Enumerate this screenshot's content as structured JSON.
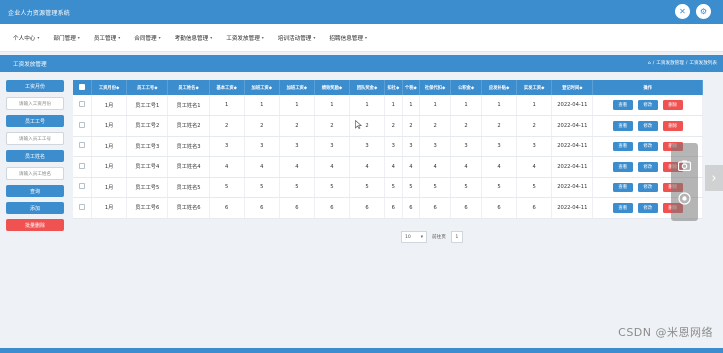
{
  "app": {
    "title": "企业人力资源管理系统"
  },
  "menu": [
    {
      "label": "个人中心"
    },
    {
      "label": "部门管理"
    },
    {
      "label": "员工管理"
    },
    {
      "label": "合同管理"
    },
    {
      "label": "考勤信息管理"
    },
    {
      "label": "工资发放管理"
    },
    {
      "label": "培训活动管理"
    },
    {
      "label": "招聘信息管理"
    }
  ],
  "section": {
    "title": "工资发放管理",
    "breadcrumb": [
      "⌂",
      "/",
      "工资发放管理",
      "/",
      "工资发放列表"
    ]
  },
  "filters": {
    "month_label": "工资月份",
    "month_placeholder": "请输入工资月份",
    "employee_no_label": "员工工号",
    "employee_no_placeholder": "请输入员工工号",
    "employee_name_label": "员工姓名",
    "employee_name_placeholder": "请输入员工姓名",
    "search_button": "查询",
    "add_button": "添加",
    "batch_delete_button": "批量删除"
  },
  "table": {
    "headers": [
      "",
      "工资月份◆",
      "员工工号◆",
      "员工姓名◆",
      "基本工资◆",
      "加班工资◆",
      "加班工资◆",
      "绩效奖励◆",
      "团队奖金◆",
      "扣社◆",
      "个税◆",
      "社保代扣◆",
      "公积金◆",
      "应发补贴◆",
      "实发工资◆",
      "登记时间◆",
      "操作"
    ],
    "rows": [
      [
        "",
        "1月",
        "员工工号1",
        "员工姓名1",
        "1",
        "1",
        "1",
        "1",
        "1",
        "1",
        "1",
        "1",
        "1",
        "1",
        "1",
        "2022-04-11"
      ],
      [
        "",
        "1月",
        "员工工号2",
        "员工姓名2",
        "2",
        "2",
        "2",
        "2",
        "2",
        "2",
        "2",
        "2",
        "2",
        "2",
        "2",
        "2022-04-11"
      ],
      [
        "",
        "1月",
        "员工工号3",
        "员工姓名3",
        "3",
        "3",
        "3",
        "3",
        "3",
        "3",
        "3",
        "3",
        "3",
        "3",
        "3",
        "2022-04-11"
      ],
      [
        "",
        "1月",
        "员工工号4",
        "员工姓名4",
        "4",
        "4",
        "4",
        "4",
        "4",
        "4",
        "4",
        "4",
        "4",
        "4",
        "4",
        "2022-04-11"
      ],
      [
        "",
        "1月",
        "员工工号5",
        "员工姓名5",
        "5",
        "5",
        "5",
        "5",
        "5",
        "5",
        "5",
        "5",
        "5",
        "5",
        "5",
        "2022-04-11"
      ],
      [
        "",
        "1月",
        "员工工号6",
        "员工姓名6",
        "6",
        "6",
        "6",
        "6",
        "6",
        "6",
        "6",
        "6",
        "6",
        "6",
        "6",
        "2022-04-11"
      ]
    ],
    "actions": {
      "view": "查看",
      "edit": "修改",
      "delete": "删除"
    }
  },
  "pagination": {
    "page_size": "10",
    "goto_label": "前往页",
    "current_page": "1"
  },
  "watermark": "CSDN @米恩网络",
  "colors": {
    "primary": "#3c8dce",
    "danger": "#f05252"
  },
  "icons": {
    "close": "close-icon",
    "settings": "gear-icon",
    "camera": "camera-icon",
    "screenshot": "lens-icon",
    "next": "chevron-right-icon"
  }
}
